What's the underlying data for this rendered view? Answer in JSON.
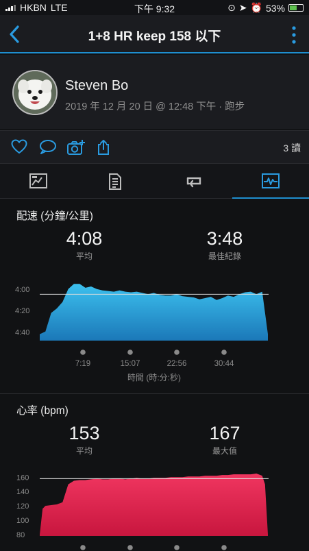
{
  "status_bar": {
    "carrier": "HKBN",
    "network": "LTE",
    "time": "下午 9:32",
    "battery": "53%",
    "battery_level": 0.53
  },
  "nav": {
    "title": "1+8 HR keep 158 以下",
    "back_icon": "back-chevron-icon",
    "more_icon": "more-vertical-icon"
  },
  "profile": {
    "name": "Steven Bo",
    "meta": "2019 年 12 月 20 日 @ 12:48 下午 · 跑步"
  },
  "social": {
    "reads": "3 讀",
    "icons": [
      "heart-icon",
      "comment-icon",
      "add-photo-icon",
      "share-icon"
    ],
    "accent": "#1f8fd0"
  },
  "tabs": [
    "overview-icon",
    "details-icon",
    "laps-icon",
    "stats-icon"
  ],
  "pace": {
    "title": "配速 (分鐘/公里)",
    "avg_value": "4:08",
    "avg_label": "平均",
    "best_value": "3:48",
    "best_label": "最佳紀錄",
    "color": "#27a5dd"
  },
  "heart_rate": {
    "title": "心率 (bpm)",
    "avg_value": "153",
    "avg_label": "平均",
    "max_value": "167",
    "max_label": "最大值",
    "color": "#e8264e"
  },
  "chart_data": [
    {
      "type": "area",
      "y_tick_labels": [
        "4:00",
        "4:20",
        "4:40"
      ],
      "y_ticks_minutes": [
        4.0,
        4.333,
        4.667
      ],
      "y_inverted": true,
      "ylim_minutes": [
        3.8,
        4.8
      ],
      "reference_line_minutes": 4.08,
      "x_tick_labels": [
        "7:19",
        "15:07",
        "22:56",
        "30:44"
      ],
      "x_axis_label": "時間 (時:分:秒)",
      "x_range_minutes": [
        0,
        40
      ],
      "series": [
        {
          "points_minutes": [
            [
              0,
              4.7
            ],
            [
              1,
              4.66
            ],
            [
              2,
              4.37
            ],
            [
              3,
              4.3
            ],
            [
              4,
              4.2
            ],
            [
              5,
              4.0
            ],
            [
              6,
              3.92
            ],
            [
              7,
              3.92
            ],
            [
              8,
              3.98
            ],
            [
              9,
              3.96
            ],
            [
              10,
              4.0
            ],
            [
              11,
              4.02
            ],
            [
              12,
              4.03
            ],
            [
              13,
              4.04
            ],
            [
              14,
              4.02
            ],
            [
              15,
              4.04
            ],
            [
              16,
              4.05
            ],
            [
              17,
              4.04
            ],
            [
              18,
              4.06
            ],
            [
              19,
              4.08
            ],
            [
              20,
              4.06
            ],
            [
              21,
              4.09
            ],
            [
              22,
              4.1
            ],
            [
              23,
              4.1
            ],
            [
              24,
              4.08
            ],
            [
              25,
              4.11
            ],
            [
              26,
              4.12
            ],
            [
              27,
              4.13
            ],
            [
              28,
              4.16
            ],
            [
              29,
              4.14
            ],
            [
              30,
              4.12
            ],
            [
              31,
              4.17
            ],
            [
              32,
              4.14
            ],
            [
              33,
              4.1
            ],
            [
              34,
              4.12
            ],
            [
              35,
              4.08
            ],
            [
              36,
              4.05
            ],
            [
              37,
              4.04
            ],
            [
              38,
              4.08
            ],
            [
              39,
              4.04
            ],
            [
              40,
              4.7
            ]
          ]
        }
      ]
    },
    {
      "type": "area",
      "y_tick_labels": [
        "160",
        "140",
        "120",
        "100",
        "80"
      ],
      "ylim": [
        78,
        166
      ],
      "reference_line": 158,
      "x_range_minutes": [
        0,
        40
      ],
      "series": [
        {
          "values_bpm": [
            [
              0,
              80
            ],
            [
              0.5,
              116
            ],
            [
              1,
              120
            ],
            [
              2,
              121
            ],
            [
              3,
              122
            ],
            [
              4,
              125
            ],
            [
              5,
              150
            ],
            [
              6,
              155
            ],
            [
              7,
              156
            ],
            [
              8,
              156
            ],
            [
              9,
              157
            ],
            [
              10,
              158
            ],
            [
              11,
              157
            ],
            [
              12,
              157
            ],
            [
              13,
              158
            ],
            [
              14,
              158
            ],
            [
              15,
              157
            ],
            [
              16,
              158
            ],
            [
              17,
              159
            ],
            [
              18,
              158
            ],
            [
              19,
              158
            ],
            [
              20,
              159
            ],
            [
              21,
              159
            ],
            [
              22,
              159
            ],
            [
              23,
              160
            ],
            [
              24,
              160
            ],
            [
              25,
              160
            ],
            [
              26,
              161
            ],
            [
              27,
              161
            ],
            [
              28,
              161
            ],
            [
              29,
              162
            ],
            [
              30,
              162
            ],
            [
              31,
              162
            ],
            [
              32,
              163
            ],
            [
              33,
              163
            ],
            [
              34,
              164
            ],
            [
              35,
              164
            ],
            [
              36,
              164
            ],
            [
              37,
              164
            ],
            [
              38,
              165
            ],
            [
              39,
              162
            ],
            [
              39.5,
              150
            ],
            [
              40,
              80
            ]
          ]
        }
      ]
    }
  ]
}
